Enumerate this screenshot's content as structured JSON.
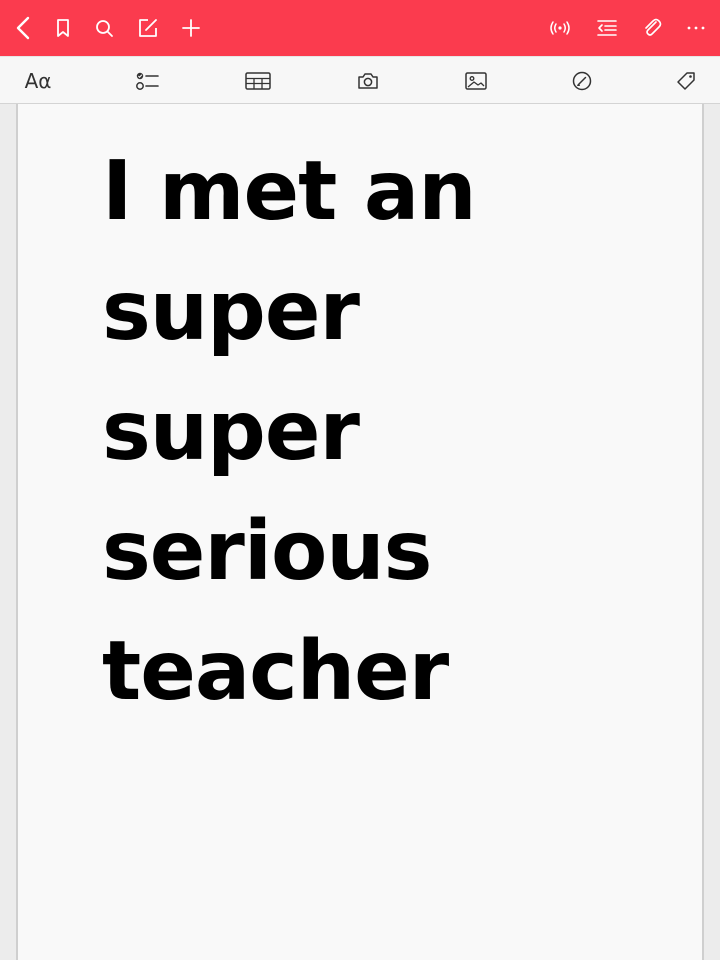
{
  "colors": {
    "toolbar_bg": "#fb3b4e",
    "toolbar_icon": "#ffffff",
    "format_bar_bg": "#f7f7f7",
    "format_icon": "#333333",
    "page_bg": "#f9f9f9",
    "text": "#000000"
  },
  "toolbar": {
    "left_icons": [
      "back-icon",
      "bookmark-icon",
      "search-icon",
      "edit-icon",
      "add-icon"
    ],
    "right_icons": [
      "broadcast-icon",
      "indent-list-icon",
      "attachment-icon",
      "more-icon"
    ]
  },
  "format_bar": {
    "font_label": "Aα",
    "icons": [
      "checklist-icon",
      "table-icon",
      "camera-icon",
      "image-icon",
      "sketch-icon",
      "tag-icon"
    ]
  },
  "note": {
    "lines": [
      "I met an",
      "super",
      "super",
      "serious",
      "teacher"
    ]
  }
}
